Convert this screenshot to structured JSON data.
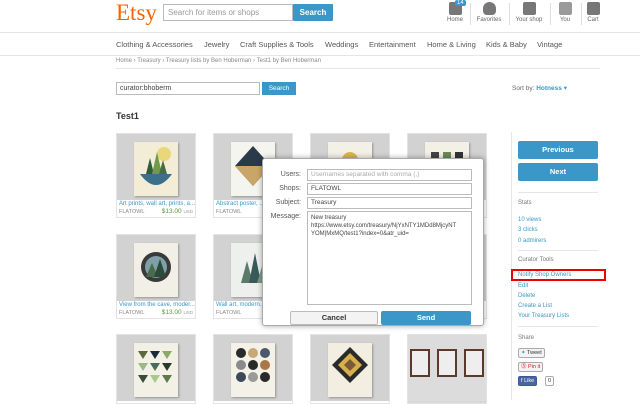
{
  "header": {
    "logo": "Etsy",
    "search_placeholder": "Search for items or shops",
    "search_button": "Search",
    "nav": {
      "home": "Home",
      "home_badge": "14",
      "favorites": "Favorites",
      "your_shop": "Your shop",
      "you": "You",
      "cart": "Cart"
    }
  },
  "categories": [
    "Clothing & Accessories",
    "Jewelry",
    "Craft Supplies & Tools",
    "Weddings",
    "Entertainment",
    "Home & Living",
    "Kids & Baby",
    "Vintage"
  ],
  "breadcrumb": "Home › Treasury › Treasury lists by Ben Hoberman › Test1 by Ben Hoberman",
  "curator_search": {
    "value": "curator:bhoberm",
    "button": "Search"
  },
  "sort": {
    "label": "Sort by:",
    "value": "Hotness"
  },
  "page_title": "Test1",
  "items": [
    {
      "caption": "Art prints, wall art, prints, a...",
      "shop": "FLATOWL",
      "price": "$13.00",
      "currency": "USD"
    },
    {
      "caption": "Abstract poster, ...",
      "shop": "FLATOWL",
      "price": "",
      "currency": ""
    },
    {
      "caption": "",
      "shop": "",
      "price": "",
      "currency": ""
    },
    {
      "caption": "",
      "shop": "",
      "price": "",
      "currency": ""
    },
    {
      "caption": "View from the cave, moder...",
      "shop": "FLATOWL",
      "price": "$13.00",
      "currency": "USD"
    },
    {
      "caption": "Wall art, modern...",
      "shop": "FLATOWL",
      "price": "",
      "currency": ""
    },
    {
      "caption": "",
      "shop": "",
      "price": "",
      "currency": ""
    },
    {
      "caption": "",
      "shop": "",
      "price": "",
      "currency": ""
    }
  ],
  "dialog": {
    "users_label": "Users:",
    "users_placeholder": "Usernames separated with comma (,)",
    "shops_label": "Shops:",
    "shops_value": "FLATOWL",
    "subject_label": "Subject:",
    "subject_value": "Treasury",
    "message_label": "Message:",
    "message_line1": "New treasury",
    "message_line2": "https://www.etsy.com/treasury/NjYxNTY1MDd8MjcyNT",
    "message_line3": "YOM|MxMQ/test1?index=0&atr_uid=",
    "cancel": "Cancel",
    "send": "Send"
  },
  "sidebar": {
    "previous": "Previous",
    "next": "Next",
    "stats_heading": "Stats",
    "views": "10 views",
    "clicks": "3 clicks",
    "admirers": "0 admirers",
    "curator_heading": "Curator Tools",
    "links": [
      "Notify Shop Owners",
      "Edit",
      "Delete",
      "Create a List",
      "Your Treasury Lists"
    ],
    "share_heading": "Share",
    "tweet": "Tweet",
    "pin": "Pin it",
    "like": "Like",
    "like_count": "0"
  },
  "colors": {
    "brand": "#f56400",
    "accent": "#3a97c7",
    "highlight": "#e00000",
    "price": "#5a9a3a"
  }
}
